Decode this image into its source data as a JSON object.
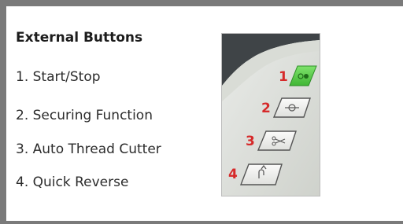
{
  "panel": {
    "title": "External Buttons",
    "items": [
      "1. Start/Stop",
      "2. Securing Function",
      "3. Auto Thread Cutter",
      "4. Quick Reverse"
    ]
  },
  "photo": {
    "markers": [
      "1",
      "2",
      "3",
      "4"
    ],
    "buttons": [
      {
        "icon": "start-stop-icon",
        "color": "#58d24b"
      },
      {
        "icon": "securing-knot-icon",
        "color": "#f3f3f3"
      },
      {
        "icon": "scissors-icon",
        "color": "#f3f3f3"
      },
      {
        "icon": "reverse-arrow-icon",
        "color": "#f3f3f3"
      }
    ],
    "marker_color": "#d62a2a"
  }
}
